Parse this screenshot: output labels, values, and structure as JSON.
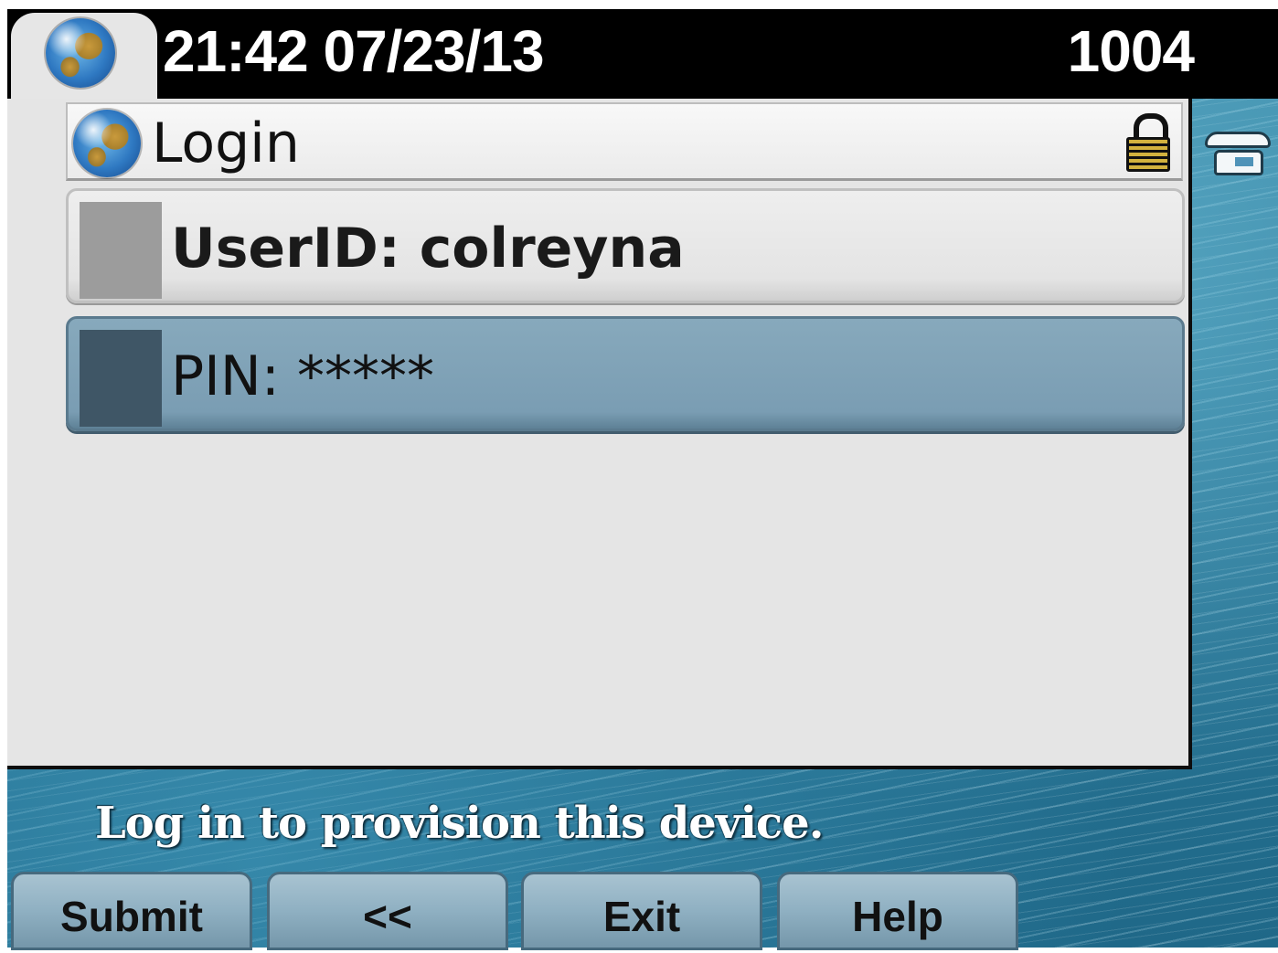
{
  "header": {
    "datetime": "21:42 07/23/13",
    "extension": "1004",
    "icon": "globe-icon"
  },
  "title_bar": {
    "title": "Login",
    "left_icon": "globe-icon",
    "right_icon": "lock-icon"
  },
  "fields": [
    {
      "label": "UserID:",
      "value": "colreyna",
      "display": "UserID: colreyna",
      "selected": false
    },
    {
      "label": "PIN:",
      "value": "*****",
      "display": "PIN: *****",
      "selected": true
    }
  ],
  "side_icon": "phone-icon",
  "prompt": "Log in to provision this device.",
  "softkeys": [
    "Submit",
    "<<",
    "Exit",
    "Help"
  ],
  "colors": {
    "header_bg": "#000000",
    "panel_bg": "#e5e5e5",
    "selected_row": "#7a9db3",
    "softkey": "#8fb0c2",
    "wallpaper": "#2a7797"
  }
}
